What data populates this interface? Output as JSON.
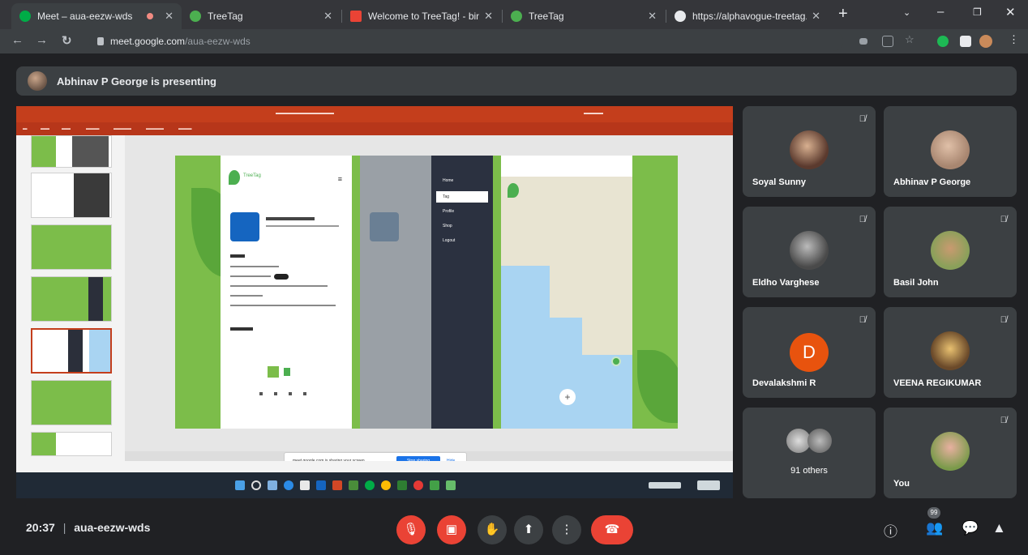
{
  "browser": {
    "tabs": [
      {
        "title": "Meet – aua-eezw-wds",
        "favicon_color": "#00ac47",
        "active": true
      },
      {
        "title": "TreeTag",
        "favicon_color": "#4caf50"
      },
      {
        "title": "Welcome to TreeTag! - binu",
        "favicon_color": "#ea4335"
      },
      {
        "title": "TreeTag",
        "favicon_color": "#4caf50"
      },
      {
        "title": "https://alphavogue-treetag.",
        "favicon_color": "#e8eaed"
      }
    ],
    "url_host": "meet.google.com",
    "url_path": "/aua-eezw-wds"
  },
  "meet": {
    "presenting_text": "Abhinav P George is presenting",
    "meeting_time": "20:37",
    "meeting_code": "aua-eezw-wds",
    "participant_badge": "99",
    "accent_red": "#ea4335"
  },
  "participants": [
    {
      "name": "Soyal Sunny",
      "muted": true,
      "avatar_color": "#5b3a2e"
    },
    {
      "name": "Abhinav P George",
      "muted": false,
      "avatar_color": "#a88670"
    },
    {
      "name": "Eldho Varghese",
      "muted": true,
      "avatar_color": "#4a4a4a"
    },
    {
      "name": "Basil John",
      "muted": true,
      "avatar_color": "#8aa05a"
    },
    {
      "name": "Devalakshmi R",
      "muted": true,
      "letter": "D",
      "avatar_color": "#e8530e"
    },
    {
      "name": "VEENA REGIKUMAR",
      "muted": true,
      "avatar_color": "#6b4a2a"
    },
    {
      "name": "91 others",
      "muted": false,
      "avatar_color": "#9a9a9a"
    },
    {
      "name": "You",
      "muted": true,
      "avatar_color": "#c98a8a"
    }
  ],
  "shared_screen": {
    "share_notice": "meet.google.com is sharing your screen.",
    "stop_sharing": "Stop sharing",
    "hide": "Hide",
    "phone_menu": [
      "Home",
      "Tag",
      "Profile",
      "Shop",
      "Logout"
    ],
    "app_name": "TreeTag"
  }
}
